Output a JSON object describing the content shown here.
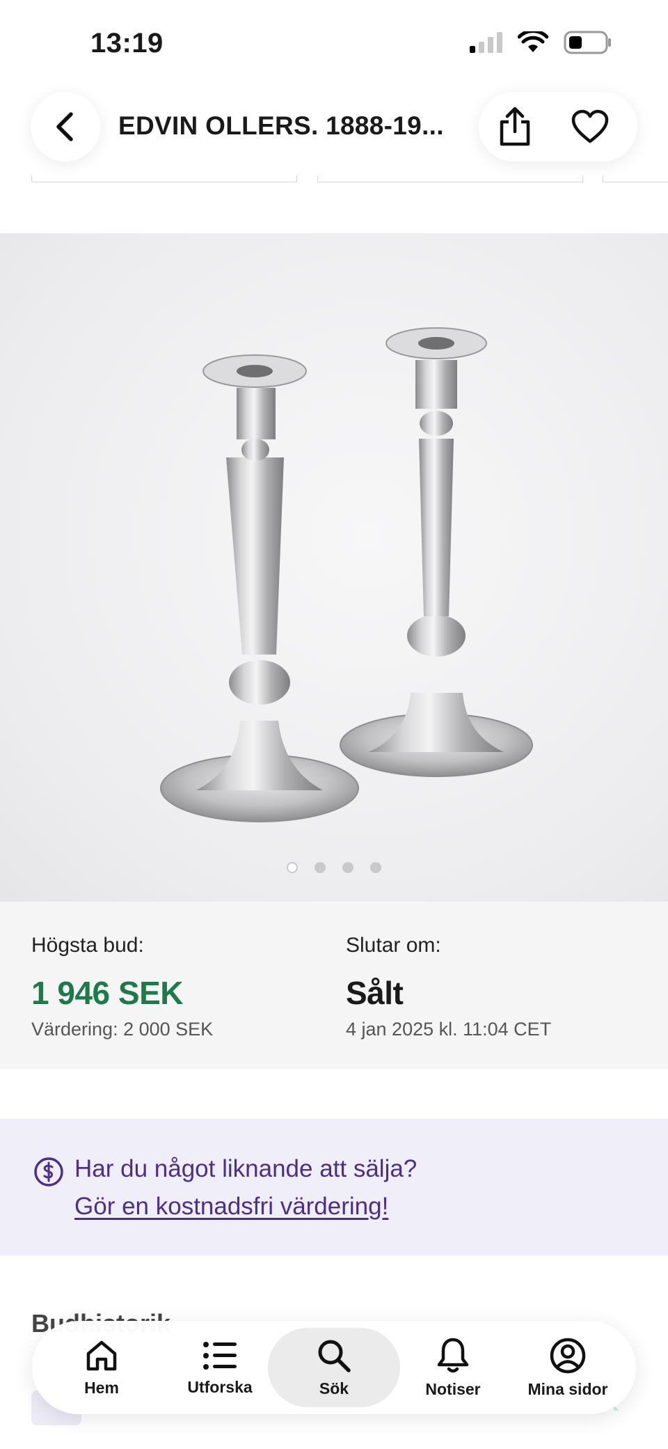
{
  "status_bar": {
    "time": "13:19"
  },
  "header": {
    "title": "EDVIN OLLERS. 1888-19..."
  },
  "gallery": {
    "image_alt": "",
    "dots": 4,
    "active_dot": 0
  },
  "bid_info": {
    "highest_bid_label": "Högsta bud:",
    "highest_bid_value": "1 946 SEK",
    "estimate_text": "Värdering: 2 000 SEK",
    "ends_label": "Slutar om:",
    "ends_value": "Sålt",
    "ends_date": "4 jan 2025 kl. 11:04 CET"
  },
  "sell_banner": {
    "question": "Har du något liknande att sälja?",
    "link": "Gör en kostnadsfri värdering!"
  },
  "bid_history": {
    "heading": "Budhistorik",
    "ghost_right": "EK"
  },
  "tabbar": {
    "tabs": [
      {
        "label": "Hem",
        "icon": "home-icon"
      },
      {
        "label": "Utforska",
        "icon": "list-icon"
      },
      {
        "label": "Sök",
        "icon": "search-icon",
        "active": true
      },
      {
        "label": "Notiser",
        "icon": "bell-icon"
      },
      {
        "label": "Mina sidor",
        "icon": "user-icon"
      }
    ]
  },
  "colors": {
    "accent_green": "#1d7a4b",
    "accent_purple": "#4a2f8c",
    "banner_bg": "#f0eef9"
  }
}
